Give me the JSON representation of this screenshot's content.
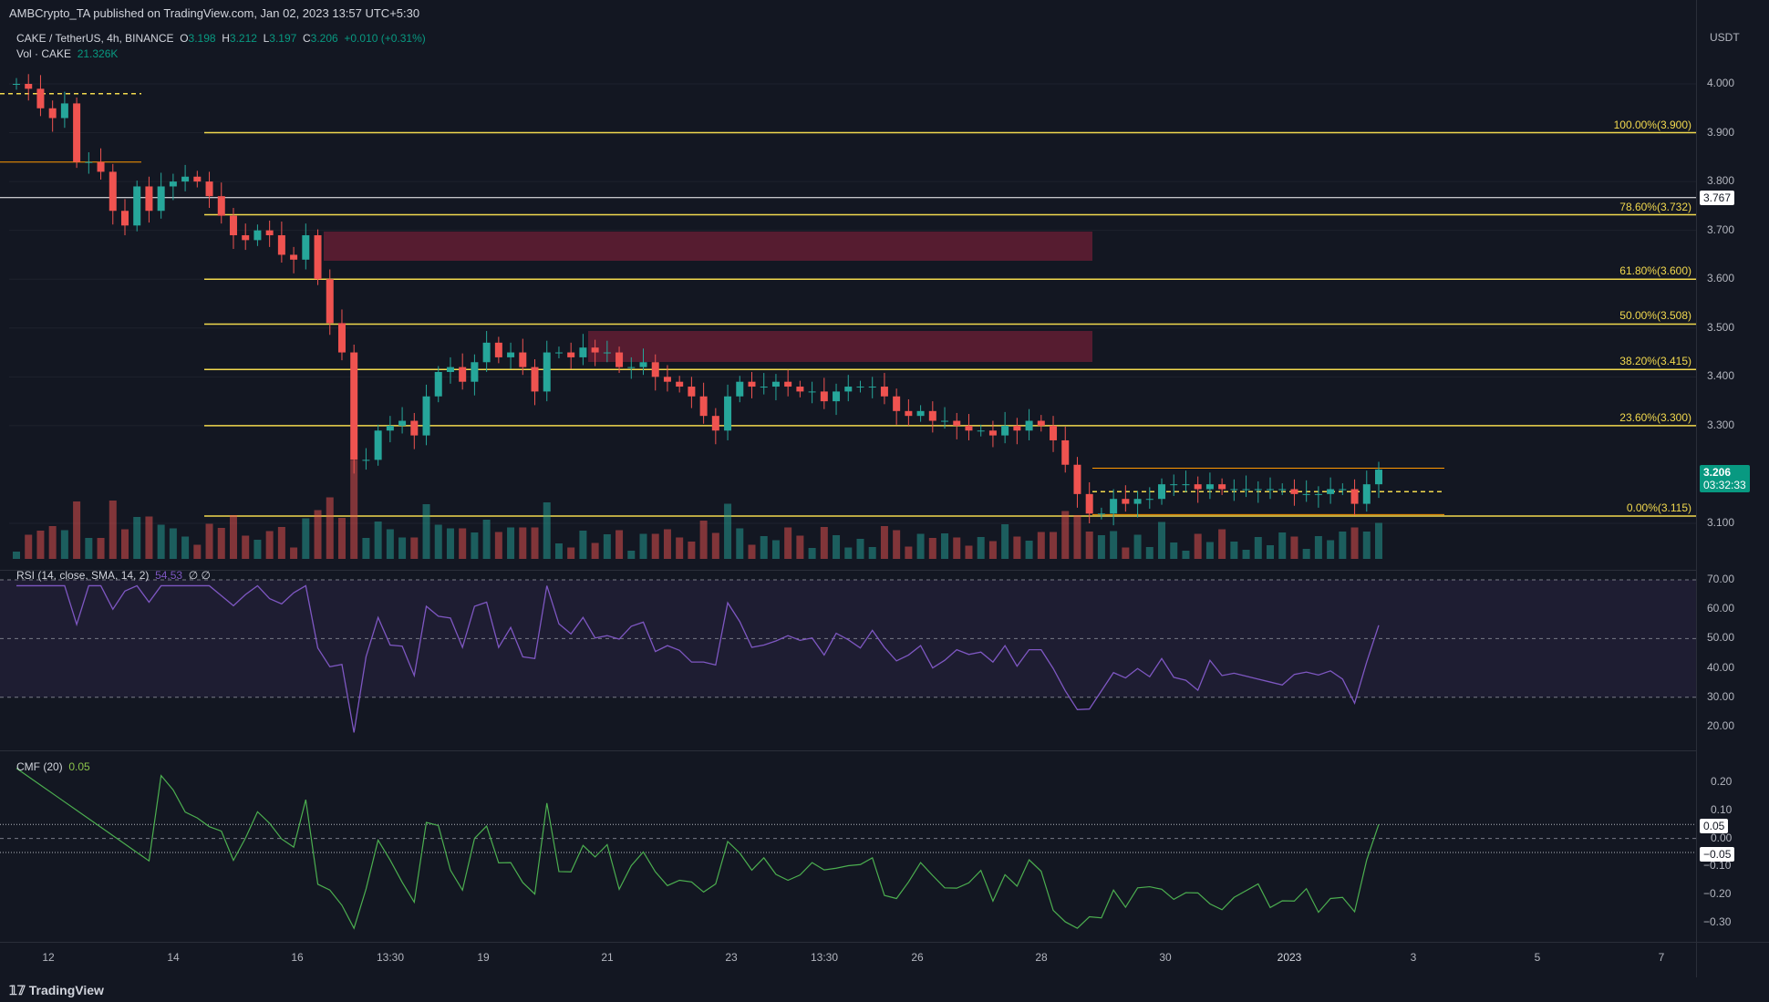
{
  "header": {
    "published": "AMBCrypto_TA published on TradingView.com, Jan 02, 2023 13:57 UTC+5:30"
  },
  "legend": {
    "symbol": "CAKE / TetherUS, 4h, BINANCE",
    "o_label": "O",
    "o": "3.198",
    "h_label": "H",
    "h": "3.212",
    "l_label": "L",
    "l": "3.197",
    "c_label": "C",
    "c": "3.206",
    "change": "+0.010 (+0.31%)",
    "vol_label": "Vol · CAKE",
    "vol": "21.326K",
    "rsi_label": "RSI (14, close, SMA, 14, 2)",
    "rsi_value": "54.53",
    "rsi_extra": "∅ ∅",
    "cmf_label": "CMF (20)",
    "cmf_value": "0.05"
  },
  "price_axis": {
    "currency": "USDT",
    "ticks": [
      "4.000",
      "3.900",
      "3.800",
      "3.700",
      "3.600",
      "3.500",
      "3.400",
      "3.300",
      "3.100"
    ],
    "white_level": "3.767",
    "last_price": "3.206",
    "countdown": "03:32:33"
  },
  "rsi_axis": {
    "ticks": [
      "70.00",
      "60.00",
      "50.00",
      "40.00",
      "30.00",
      "20.00"
    ]
  },
  "cmf_axis": {
    "ticks": [
      "0.20",
      "0.10",
      "0.00",
      "−0.10",
      "−0.20",
      "−0.30"
    ],
    "badge_pos": "0.05",
    "badge_neg": "−0.05"
  },
  "fib_levels": [
    {
      "label": "100.00%(3.900)",
      "price": 3.9
    },
    {
      "label": "78.60%(3.732)",
      "price": 3.732
    },
    {
      "label": "61.80%(3.600)",
      "price": 3.6
    },
    {
      "label": "50.00%(3.508)",
      "price": 3.508
    },
    {
      "label": "38.20%(3.415)",
      "price": 3.415
    },
    {
      "label": "23.60%(3.300)",
      "price": 3.3
    },
    {
      "label": "0.00%(3.115)",
      "price": 3.115
    }
  ],
  "dates": [
    "12",
    "14",
    "16",
    "13:30",
    "19",
    "21",
    "23",
    "13:30",
    "26",
    "28",
    "30",
    "2023",
    "3",
    "5",
    "7"
  ],
  "footer": {
    "brand": "TradingView"
  },
  "colors": {
    "up": "#26a69a",
    "down": "#ef5350",
    "fib": "#f2d94e",
    "rsi": "#7e57c2",
    "cmf": "#4caf50",
    "zone": "#6e1f35",
    "bg": "#131722"
  },
  "chart_data": {
    "type": "candlestick",
    "title": "CAKE / TetherUS, 4h, BINANCE",
    "ylim": [
      3.03,
      4.05
    ],
    "candles_close": [
      4.0,
      3.99,
      3.95,
      3.93,
      3.96,
      3.84,
      3.84,
      3.82,
      3.74,
      3.71,
      3.79,
      3.74,
      3.79,
      3.8,
      3.81,
      3.8,
      3.77,
      3.73,
      3.69,
      3.68,
      3.7,
      3.69,
      3.65,
      3.64,
      3.69,
      3.6,
      3.51,
      3.45,
      3.23,
      3.23,
      3.29,
      3.3,
      3.31,
      3.28,
      3.36,
      3.41,
      3.42,
      3.39,
      3.43,
      3.47,
      3.44,
      3.45,
      3.42,
      3.37,
      3.45,
      3.45,
      3.44,
      3.46,
      3.45,
      3.45,
      3.42,
      3.42,
      3.43,
      3.4,
      3.39,
      3.38,
      3.36,
      3.32,
      3.29,
      3.36,
      3.39,
      3.38,
      3.38,
      3.39,
      3.38,
      3.37,
      3.37,
      3.35,
      3.37,
      3.38,
      3.38,
      3.38,
      3.36,
      3.33,
      3.32,
      3.33,
      3.31,
      3.31,
      3.3,
      3.29,
      3.29,
      3.28,
      3.3,
      3.29,
      3.31,
      3.3,
      3.27,
      3.22,
      3.16,
      3.12,
      3.12,
      3.15,
      3.14,
      3.15,
      3.15,
      3.18,
      3.18,
      3.18,
      3.17,
      3.18,
      3.17,
      3.17,
      3.17,
      3.17,
      3.17,
      3.17,
      3.16,
      3.16,
      3.16,
      3.17,
      3.17,
      3.14,
      3.18,
      3.21
    ],
    "rsi_last": 54.53,
    "cmf_last": 0.05
  }
}
